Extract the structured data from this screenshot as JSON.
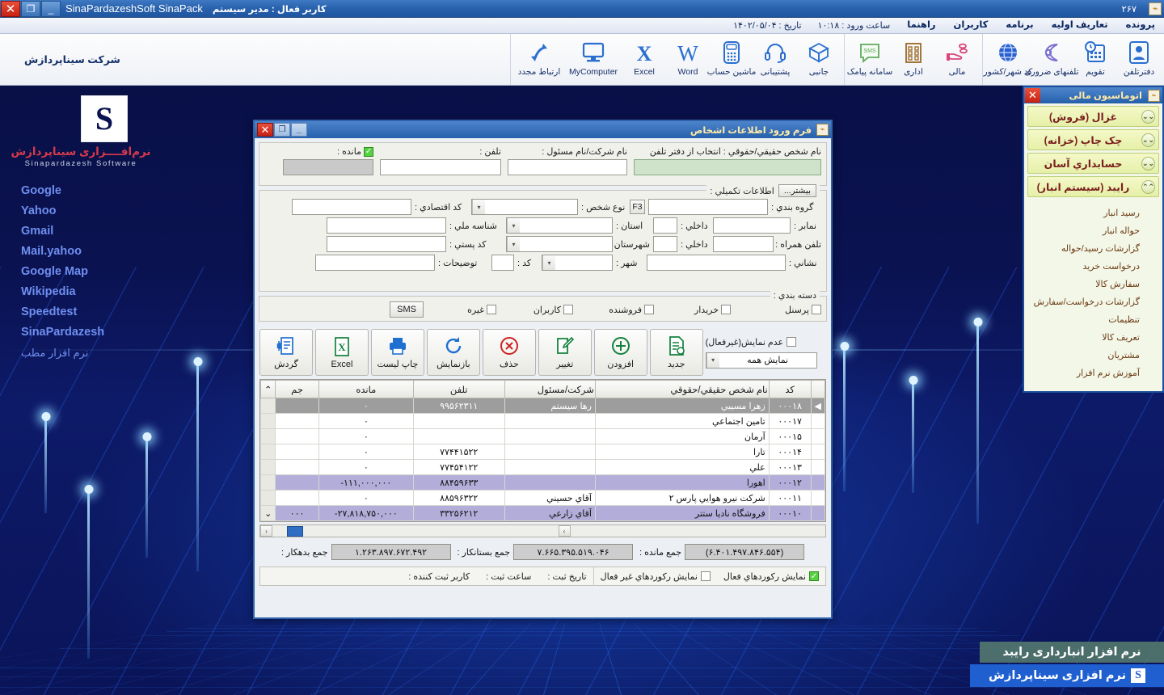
{
  "window": {
    "app_title": "SinaPardazeshSoft SinaPack",
    "active_user": "کاربر فعال : مدیر سیستم",
    "record_number": "۲۶۷",
    "minimize": "_",
    "restore": "❐",
    "close": "✕",
    "app_icon": "sina-logo-icon"
  },
  "menubar": {
    "items": [
      "پرونده",
      "تعاریف اولیه",
      "برنامه",
      "کاربران",
      "راهنما"
    ],
    "login_time_label": "ساعت ورود : ۱۰:۱۸",
    "date_label": "تاریخ : ۱۴۰۲/۰۵/۰۴"
  },
  "ribbon": {
    "company": "شرکت سیناپردازش",
    "groups": [
      {
        "buttons": [
          {
            "label": "ارتباط مجدد",
            "icon": "refresh-arrows-icon"
          },
          {
            "label": "MyComputer",
            "icon": "monitor-icon"
          },
          {
            "label": "Excel",
            "icon": "excel-x-icon"
          },
          {
            "label": "Word",
            "icon": "word-w-icon"
          },
          {
            "label": "ماشین حساب",
            "icon": "calculator-icon"
          },
          {
            "label": "پشتیبانی",
            "icon": "headset-icon"
          },
          {
            "label": "جانبی",
            "icon": "box-icon"
          }
        ]
      },
      {
        "buttons": [
          {
            "label": "سامانه پیامک",
            "icon": "sms-bubble-icon"
          },
          {
            "label": "اداری",
            "icon": "office-building-icon"
          },
          {
            "label": "مالی",
            "icon": "hand-coins-icon"
          }
        ]
      },
      {
        "buttons": [
          {
            "label": "کد شهر/کشور",
            "icon": "globe-icon"
          },
          {
            "label": "تلفنهای ضروری",
            "icon": "phone-handset-icon"
          },
          {
            "label": "تقویم",
            "icon": "calendar-clock-icon"
          },
          {
            "label": "دفترتلفن",
            "icon": "contact-card-icon"
          }
        ]
      }
    ]
  },
  "leftpanel": {
    "logo_glyph": "S",
    "logo_fa": "نرم‌افــــزاری سیناپردازش",
    "logo_en": "Sinapardazesh Software",
    "links": [
      {
        "label": "Google",
        "rtl": false
      },
      {
        "label": "Yahoo",
        "rtl": false
      },
      {
        "label": "Gmail",
        "rtl": false
      },
      {
        "label": "Mail.yahoo",
        "rtl": false
      },
      {
        "label": "Google Map",
        "rtl": false
      },
      {
        "label": "Wikipedia",
        "rtl": false
      },
      {
        "label": "Speedtest",
        "rtl": false
      },
      {
        "label": "SinaPardazesh",
        "rtl": false
      },
      {
        "label": "نرم افزار مطب",
        "rtl": true
      }
    ]
  },
  "autopanel": {
    "title": "اتوماسیون مالی",
    "close": "✕",
    "sections": [
      {
        "label": "غزال (فروش)",
        "expanded": false,
        "chevron": "⌄⌄"
      },
      {
        "label": "چک چاپ (خزانه)",
        "expanded": false,
        "chevron": "⌄⌄"
      },
      {
        "label": "حسابداري آسان",
        "expanded": false,
        "chevron": "⌄⌄"
      },
      {
        "label": "رایبد (سیستم انبار)",
        "expanded": true,
        "chevron": "⌃⌃"
      }
    ],
    "subitems": [
      "رسید انبار",
      "حواله انبار",
      "گزارشات رسید/حواله",
      "درخواست خرید",
      "سفارش کالا",
      "گزارشات درخواست/سفارش",
      "تنظیمات",
      "تعریف کالا",
      "مشتریان",
      "آموزش نرم افزار"
    ]
  },
  "banners": {
    "product": "نرم افزار انبارداری رایبد",
    "company": "نرم افزاری سیناپردازش",
    "company_icon": "sina-mark-icon"
  },
  "dialog": {
    "title": "فرم ورود اطلاعات اشخاص",
    "icon": "form-icon",
    "minimize": "_",
    "restore": "❐",
    "close": "✕",
    "top_fields": {
      "name_label": "نام شخص حقیقي/حقوقي : انتخاب از دفتر تلفن",
      "name_value": "",
      "company_label": "نام شرکت/نام مسئول :",
      "company_value": "",
      "phone_label": "تلفن :",
      "phone_value": "",
      "balance_label": "مانده :",
      "balance_value": "",
      "balance_checked": true
    },
    "extra_panel": {
      "title": "اطلاعات تکمیلي :",
      "more_button": "بیشتر...",
      "rows": [
        {
          "label": "گروه بندي :",
          "value": "",
          "hotkey": "F3",
          "mid_label": "نوع شخص :",
          "mid_value": "",
          "mid_type": "combo",
          "right_label": "کد اقتصادي :",
          "right_value": ""
        },
        {
          "label": "نمابر :",
          "value": "",
          "inner_label": "داخلي :",
          "inner_value": "",
          "mid_label": "استان :",
          "mid_value": "",
          "mid_type": "combo",
          "right_label": "شناسه ملي :",
          "right_value": ""
        },
        {
          "label": "تلفن همراه :",
          "value": "",
          "inner_label": "داخلي :",
          "inner_value": "",
          "mid_label": "شهرستان :",
          "mid_value": "",
          "mid_type": "combo",
          "right_label": "کد پستي :",
          "right_value": ""
        },
        {
          "label": "نشاني :",
          "value": "",
          "mid_label": "شهر :",
          "mid_value": "",
          "mid_type": "combo",
          "code_label": "کد :",
          "code_value": "",
          "right_label": "توضیحات :",
          "right_value": ""
        }
      ]
    },
    "category_panel": {
      "title": "دسته بندي :",
      "sms_button": "SMS",
      "checks": [
        {
          "label": "پرسنل",
          "checked": false
        },
        {
          "label": "خریدار",
          "checked": false
        },
        {
          "label": "فروشنده",
          "checked": false
        },
        {
          "label": "کاربران",
          "checked": false
        },
        {
          "label": "غیره",
          "checked": false
        }
      ]
    },
    "toolbar": {
      "hide_inactive_label": "عدم نمایش(غیرفعال)",
      "hide_inactive_checked": false,
      "filter_value": "نمایش همه",
      "buttons": [
        {
          "label": "جدید",
          "icon": "new-document-icon"
        },
        {
          "label": "افزودن",
          "icon": "plus-circle-icon"
        },
        {
          "label": "تغییر",
          "icon": "edit-pencil-icon"
        },
        {
          "label": "حذف",
          "icon": "delete-circle-icon"
        },
        {
          "label": "بازنمایش",
          "icon": "refresh-circle-icon"
        },
        {
          "label": "چاپ لیست",
          "icon": "printer-icon"
        },
        {
          "label": "Excel",
          "icon": "excel-sheet-icon"
        },
        {
          "label": "گردش",
          "icon": "ledger-icon"
        }
      ]
    },
    "grid": {
      "columns": [
        "کد",
        "نام شخص حقیقي/حقوقي",
        "شرکت/مسئول",
        "تلفن",
        "مانده",
        "جم"
      ],
      "rows": [
        {
          "code": "۰۰۰۱۸",
          "name": "زهرا مسیبي",
          "resp": "رها سیستم",
          "tel": "۹۹۵۶۲۳۱۱",
          "bal": "۰",
          "sum": "",
          "state": "selected"
        },
        {
          "code": "۰۰۰۱۷",
          "name": "تامین اجتماعي",
          "resp": "",
          "tel": "",
          "bal": "۰",
          "sum": "",
          "state": "normal"
        },
        {
          "code": "۰۰۰۱۵",
          "name": "آرمان",
          "resp": "",
          "tel": "",
          "bal": "۰",
          "sum": "",
          "state": "normal"
        },
        {
          "code": "۰۰۰۱۴",
          "name": "تارا",
          "resp": "",
          "tel": "۷۷۴۴۱۵۲۲",
          "bal": "۰",
          "sum": "",
          "state": "normal"
        },
        {
          "code": "۰۰۰۱۳",
          "name": "علي",
          "resp": "",
          "tel": "۷۷۴۵۴۱۲۲",
          "bal": "۰",
          "sum": "",
          "state": "normal"
        },
        {
          "code": "۰۰۰۱۲",
          "name": "اهورا",
          "resp": "",
          "tel": "۸۸۴۵۹۶۳۳",
          "bal": "۱۱۱,۰۰۰,۰۰۰-",
          "sum": "",
          "state": "highlight"
        },
        {
          "code": "۰۰۰۱۱",
          "name": "شرکت نیرو هوایي پارس ۲",
          "resp": "آقاي حسیني",
          "tel": "۸۸۵۹۶۳۲۲",
          "bal": "۰",
          "sum": "",
          "state": "normal"
        },
        {
          "code": "۰۰۰۱۰",
          "name": "فروشگاه نادیا ستتر",
          "resp": "آقاي زارعي",
          "tel": "۳۳۲۵۶۲۱۲",
          "bal": "۲۷,۸۱۸,۷۵۰,۰۰۰-",
          "sum": "۰۰۰",
          "state": "highlight"
        }
      ]
    },
    "totals": [
      {
        "label": "جمع بدهکار :",
        "value": "۱.۲۶۳.۸۹۷.۶۷۲.۴۹۲"
      },
      {
        "label": "جمع بستانکار :",
        "value": "۷.۶۶۵.۳۹۵.۵۱۹.۰۴۶"
      },
      {
        "label": "جمع مانده :",
        "value": "(۶.۴۰۱.۴۹۷.۸۴۶.۵۵۴)"
      }
    ],
    "status": {
      "active_records_label": "نمایش رکوردهاي فعال",
      "active_records_checked": true,
      "inactive_records_label": "نمایش رکوردهاي غیر فعال",
      "inactive_records_checked": false,
      "reg_date_label": "تاریخ ثبت :",
      "reg_date_value": "",
      "reg_time_label": "ساعت ثبت :",
      "reg_time_value": "",
      "reg_user_label": "کاربر ثبت کننده :",
      "reg_user_value": ""
    }
  }
}
